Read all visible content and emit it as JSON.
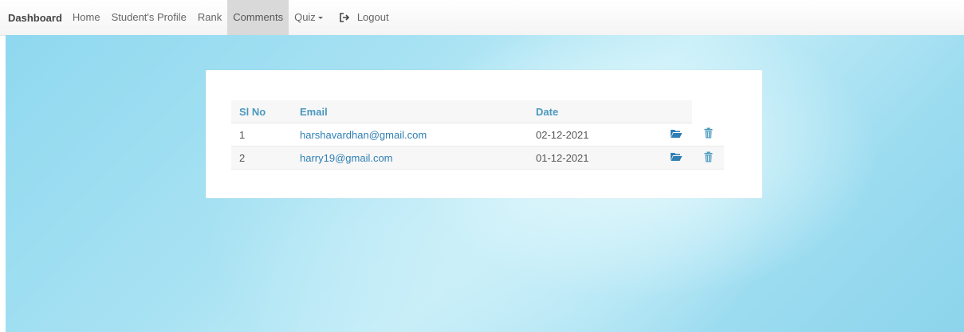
{
  "navbar": {
    "brand": "Dashboard",
    "items": [
      {
        "label": "Home",
        "active": false
      },
      {
        "label": "Student's Profile",
        "active": false
      },
      {
        "label": "Rank",
        "active": false
      },
      {
        "label": "Comments",
        "active": true
      },
      {
        "label": "Quiz",
        "active": false
      }
    ],
    "logout_label": "Logout"
  },
  "table": {
    "headers": [
      "Sl No",
      "Email",
      "Date"
    ],
    "rows": [
      {
        "no": "1",
        "email": "harshavardhan@gmail.com",
        "date": "02-12-2021"
      },
      {
        "no": "2",
        "email": "harry19@gmail.com",
        "date": "01-12-2021"
      }
    ]
  },
  "colors": {
    "accent": "#4a98bf",
    "link": "#2f7fb4",
    "icon": "#2f7fb4",
    "trash": "#4a98bf"
  }
}
